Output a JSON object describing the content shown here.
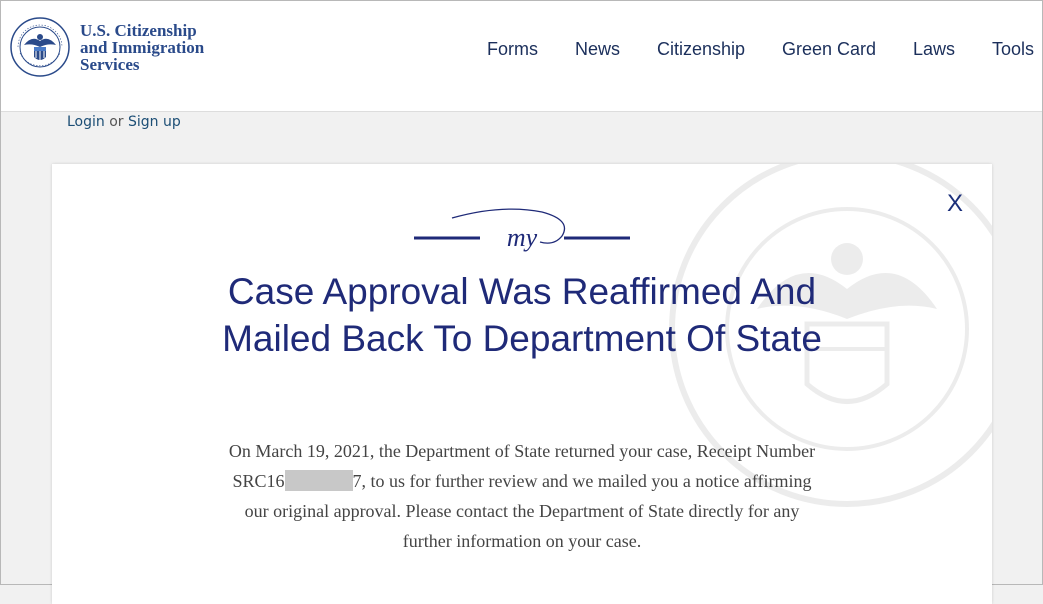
{
  "header": {
    "brand_line1": "U.S. Citizenship",
    "brand_line2": "and Immigration",
    "brand_line3": "Services",
    "nav": [
      "Forms",
      "News",
      "Citizenship",
      "Green Card",
      "Laws",
      "Tools"
    ]
  },
  "auth": {
    "login": "Login",
    "or": "or",
    "signup": "Sign up"
  },
  "modal": {
    "close_label": "X",
    "logo_text": "my",
    "title": "Case Approval Was Reaffirmed And Mailed Back To Department Of State",
    "body_part1": "On March 19, 2021, the Department of State returned your case, Receipt Number SRC16",
    "body_part2": "7, to us for further review and we mailed you a notice affirming our original approval. Please contact the Department of State directly for any further information on your case."
  },
  "colors": {
    "brand_blue": "#2a4a8a",
    "nav_text": "#1b2f5b",
    "title_blue": "#1f2a78",
    "page_bg": "#f1f1f1"
  }
}
